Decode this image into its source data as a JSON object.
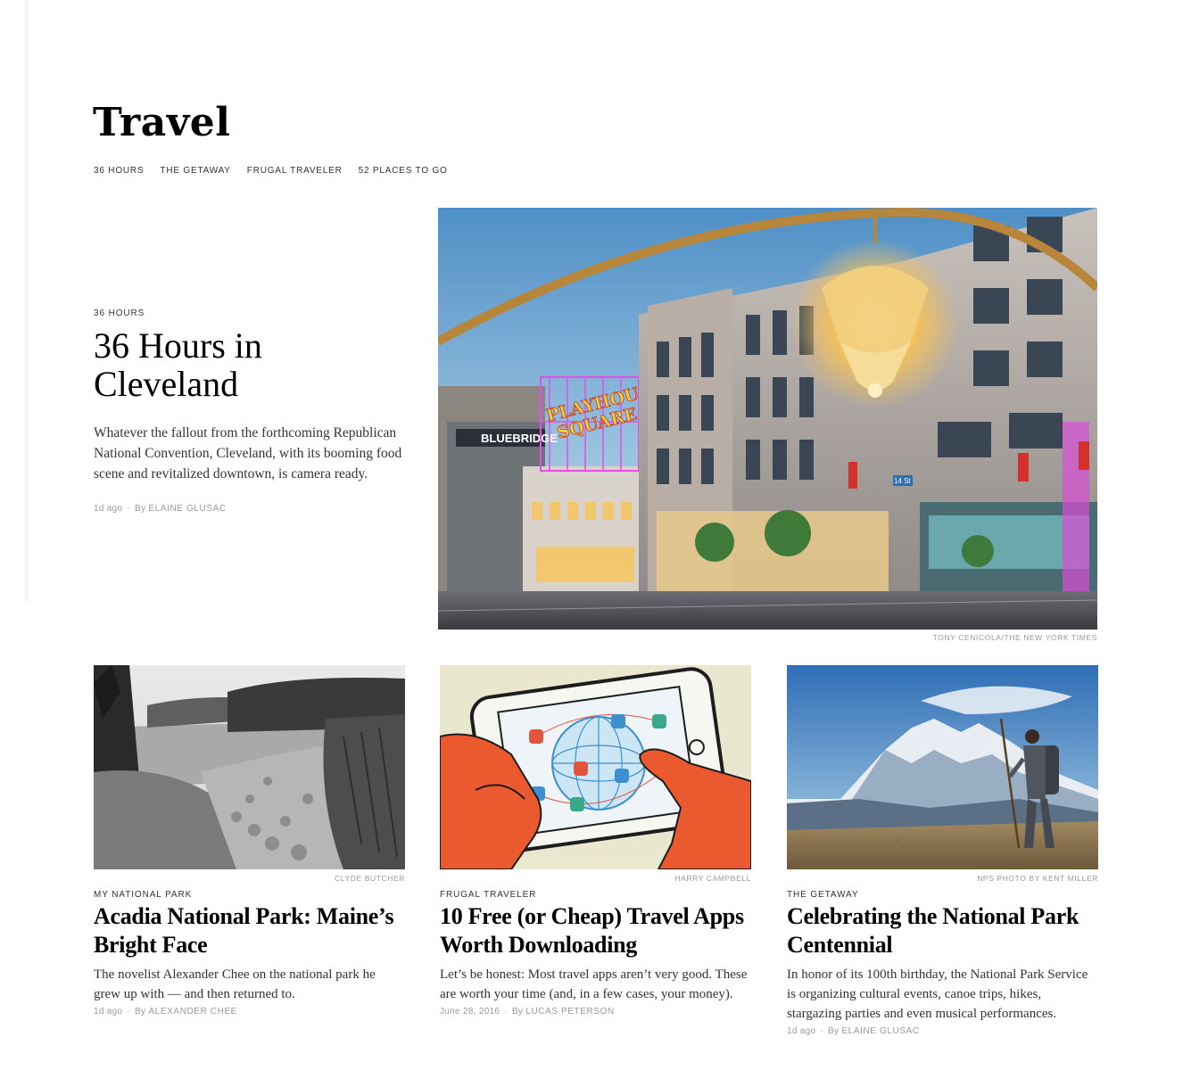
{
  "section": {
    "title": "Travel"
  },
  "subnav": [
    "36 HOURS",
    "THE GETAWAY",
    "FRUGAL TRAVELER",
    "52 PLACES TO GO"
  ],
  "lead": {
    "kicker": "36 HOURS",
    "headline": "36 Hours in Cleveland",
    "summary": "Whatever the fallout from the forthcoming Republican National Convention, Cleveland, with its booming food scene and revitalized downtown, is camera ready.",
    "time": "1d ago",
    "by": "By",
    "author": "ELAINE GLUSAC",
    "credit": "TONY CENICOLA/THE NEW YORK TIMES",
    "sign_bluebridge": "BLUEBRIDGE",
    "sign_playhouse_1": "PLAYHOUSE",
    "sign_playhouse_2": "SQUARE",
    "sign_street": "14 St"
  },
  "cards": [
    {
      "credit": "CLYDE BUTCHER",
      "kicker": "MY NATIONAL PARK",
      "headline": "Acadia National Park: Maine’s Bright Face",
      "summary": "The novelist Alexander Chee on the national park he grew up with — and then returned to.",
      "time": "1d ago",
      "by": "By",
      "author": "ALEXANDER CHEE"
    },
    {
      "credit": "HARRY CAMPBELL",
      "kicker": "FRUGAL TRAVELER",
      "headline": "10 Free (or Cheap) Travel Apps Worth Downloading",
      "summary": "Let’s be honest: Most travel apps aren’t very good. These are worth your time (and, in a few cases, your money).",
      "time": "June 28, 2016",
      "by": "By",
      "author": "LUCAS PETERSON"
    },
    {
      "credit": "NPS PHOTO BY KENT MILLER",
      "kicker": "THE GETAWAY",
      "headline": "Celebrating the National Park Centennial",
      "summary": "In honor of its 100th birthday, the National Park Service is organizing cultural events, canoe trips, hikes, stargazing parties and even musical performances.",
      "time": "1d ago",
      "by": "By",
      "author": "ELAINE GLUSAC"
    }
  ],
  "colors": {
    "text": "#121212",
    "muted": "#999999",
    "body": "#333333"
  }
}
